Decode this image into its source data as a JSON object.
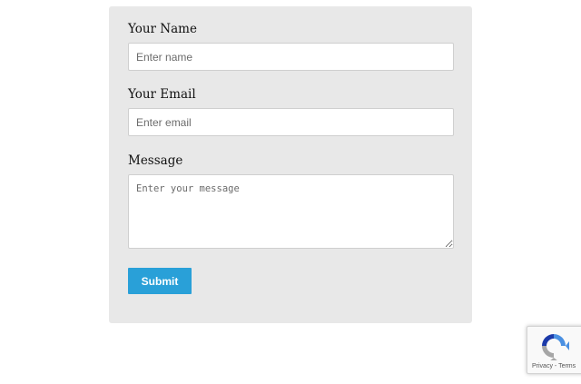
{
  "form": {
    "name_label": "Your Name",
    "name_placeholder": "Enter name",
    "email_label": "Your Email",
    "email_placeholder": "Enter email",
    "message_label": "Message",
    "message_placeholder": "Enter your message",
    "submit_label": "Submit"
  },
  "recaptcha": {
    "privacy_label": "Privacy",
    "separator": " - ",
    "terms_label": "Terms",
    "logo_icon": "recaptcha-icon"
  },
  "colors": {
    "card_background": "#e8e8e8",
    "submit_background": "#29a0d8",
    "recaptcha_blue": "#4a90e2",
    "recaptcha_gray": "#a6a6a6"
  }
}
